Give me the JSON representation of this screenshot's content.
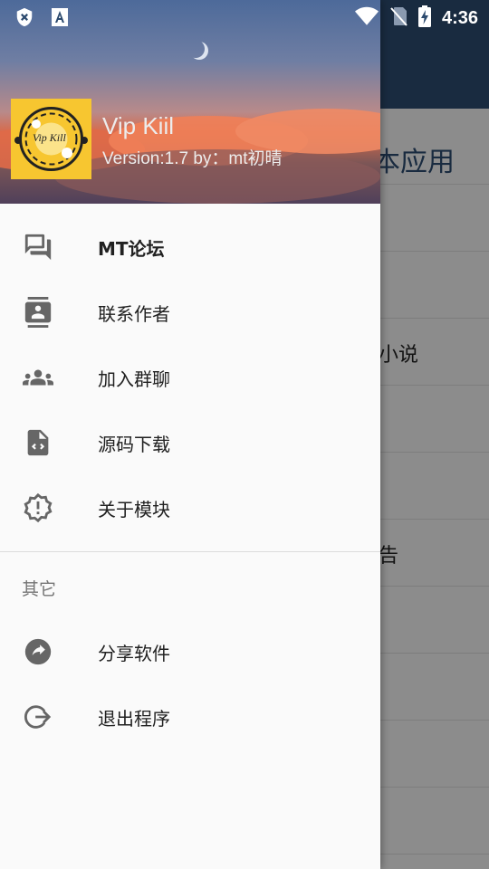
{
  "status_bar": {
    "time": "4:36",
    "icons": [
      "shield-x-icon",
      "font-a-icon",
      "wifi-icon",
      "no-sim-icon",
      "battery-charging-icon"
    ]
  },
  "drawer_header": {
    "app_name": "Vip Kiil",
    "version_text": "Version:1.7 by：mt初晴",
    "logo_text": "Vip Kill"
  },
  "menu": {
    "items": [
      {
        "label": "MT论坛",
        "icon": "forum-chat-icon"
      },
      {
        "label": "联系作者",
        "icon": "contact-card-icon"
      },
      {
        "label": "加入群聊",
        "icon": "group-icon"
      },
      {
        "label": "源码下载",
        "icon": "code-file-icon"
      },
      {
        "label": "关于模块",
        "icon": "info-badge-icon"
      }
    ],
    "section_label": "其它",
    "other_items": [
      {
        "label": "分享软件",
        "icon": "share-icon"
      },
      {
        "label": "退出程序",
        "icon": "exit-icon"
      }
    ]
  },
  "background_app": {
    "heading_fragment": "本应用",
    "row_fragments": [
      "小说",
      "告"
    ]
  },
  "colors": {
    "drawer_bg": "#fafafa",
    "toolbar": "#2c4a6e",
    "logo_bg": "#f7c630",
    "icon_gray": "#666666"
  }
}
